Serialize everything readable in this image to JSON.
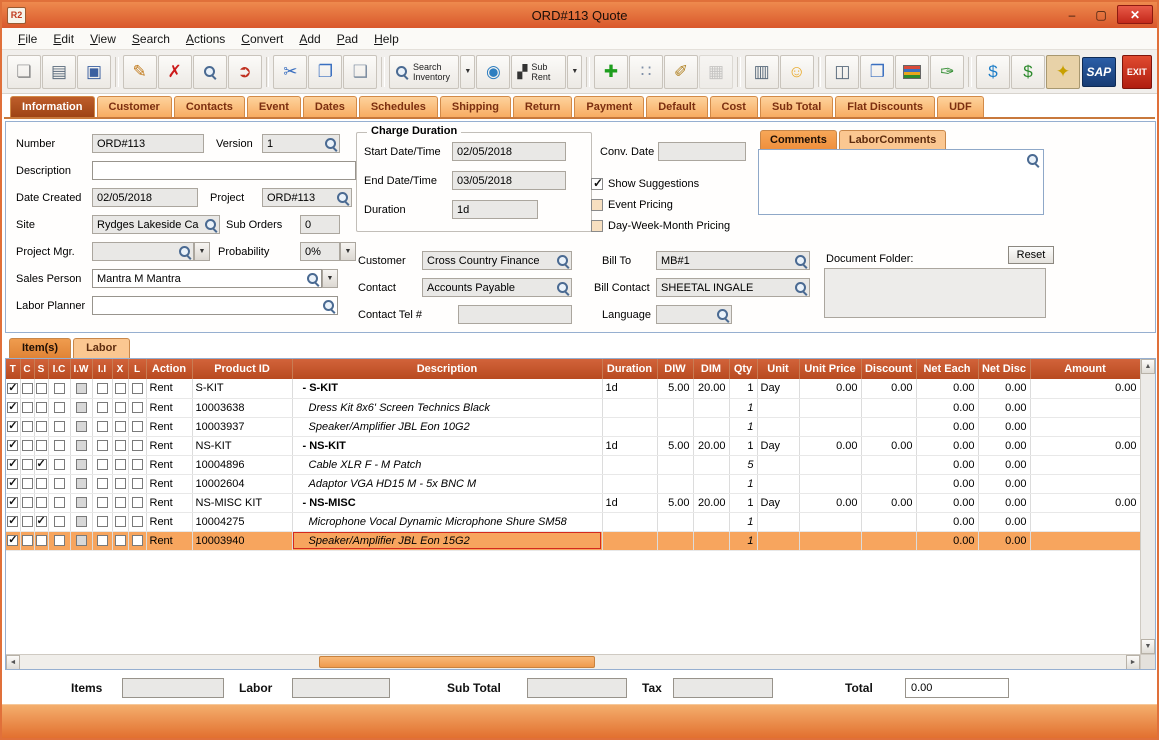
{
  "window": {
    "title": "ORD#113 Quote",
    "logo_text": "R2",
    "controls": {
      "minimize": "–",
      "maximize": "▢",
      "close": "✕"
    }
  },
  "menu": {
    "items": [
      "File",
      "Edit",
      "View",
      "Search",
      "Actions",
      "Convert",
      "Add",
      "Pad",
      "Help"
    ]
  },
  "toolbar": {
    "items": [
      {
        "name": "new-document-icon",
        "kind": "icon",
        "glyph": "❏",
        "color": "#8A8A8A"
      },
      {
        "name": "print-icon",
        "kind": "icon",
        "glyph": "▤",
        "color": "#5A6B7C"
      },
      {
        "name": "save-icon",
        "kind": "icon",
        "glyph": "▣",
        "color": "#3A5FA0"
      },
      {
        "name": "sep1",
        "kind": "sep"
      },
      {
        "name": "edit-icon",
        "kind": "icon",
        "glyph": "✎",
        "color": "#C07818"
      },
      {
        "name": "delete-icon",
        "kind": "icon",
        "glyph": "✗",
        "color": "#CC1A1A"
      },
      {
        "name": "find-icon",
        "kind": "mag"
      },
      {
        "name": "export-icon",
        "kind": "icon",
        "glyph": "➲",
        "color": "#C03020"
      },
      {
        "name": "sep2",
        "kind": "sep"
      },
      {
        "name": "cut-icon",
        "kind": "icon",
        "glyph": "✂",
        "color": "#3A6FC0"
      },
      {
        "name": "copy-icon",
        "kind": "icon",
        "glyph": "❐",
        "color": "#3A6FC0"
      },
      {
        "name": "paste-icon",
        "kind": "icon",
        "glyph": "❑",
        "color": "#7C8CA0"
      },
      {
        "name": "sep3",
        "kind": "sep"
      },
      {
        "name": "search-inventory-button",
        "kind": "labelmag",
        "label": "Search Inventory"
      },
      {
        "name": "search-inventory-dropdown",
        "kind": "dd"
      },
      {
        "name": "web-search-icon",
        "kind": "icon",
        "glyph": "◉",
        "color": "#2E7EC0"
      },
      {
        "name": "sub-rent-button",
        "kind": "label",
        "glyph": "▞",
        "color": "#333333",
        "label": "Sub Rent"
      },
      {
        "name": "sub-rent-dropdown",
        "kind": "dd"
      },
      {
        "name": "sep4",
        "kind": "sep"
      },
      {
        "name": "add-item-icon",
        "kind": "icon",
        "glyph": "✚",
        "color": "#1E9E1E"
      },
      {
        "name": "kit-group-icon",
        "kind": "icon",
        "glyph": "∷",
        "color": "#8090A8"
      },
      {
        "name": "notes-icon",
        "kind": "icon",
        "glyph": "✐",
        "color": "#B08020"
      },
      {
        "name": "grid-icon",
        "kind": "icon",
        "glyph": "▦",
        "color": "#9A9A9A",
        "disabled": true
      },
      {
        "name": "sep5",
        "kind": "sep"
      },
      {
        "name": "fax-icon",
        "kind": "icon",
        "glyph": "▥",
        "color": "#5A6B7C"
      },
      {
        "name": "smiley-icon",
        "kind": "icon",
        "glyph": "☺",
        "color": "#E8A51E"
      },
      {
        "name": "sep6",
        "kind": "sep"
      },
      {
        "name": "camera-icon",
        "kind": "icon",
        "glyph": "◫",
        "color": "#5A6B7C"
      },
      {
        "name": "package-icon",
        "kind": "icon",
        "glyph": "❒",
        "color": "#3A6FC0"
      },
      {
        "name": "catalog-stack-icon",
        "kind": "stack"
      },
      {
        "name": "document-edit-icon",
        "kind": "icon",
        "glyph": "✑",
        "color": "#2E8B2E"
      },
      {
        "name": "sep7",
        "kind": "sep"
      },
      {
        "name": "currency-transfer-icon",
        "kind": "icon",
        "glyph": "$",
        "color": "#1E7EC8"
      },
      {
        "name": "price-list-icon",
        "kind": "icon",
        "glyph": "$",
        "color": "#2E8B2E"
      },
      {
        "name": "security-key-icon",
        "kind": "icon",
        "glyph": "✦",
        "color": "#C8A000",
        "pressed": true
      }
    ],
    "sap_label": "SAP",
    "exit_label": "EXIT"
  },
  "main_tabs": [
    "Information",
    "Customer",
    "Contacts",
    "Event",
    "Dates",
    "Schedules",
    "Shipping",
    "Return",
    "Payment",
    "Default",
    "Cost",
    "Sub Total",
    "Flat Discounts",
    "UDF"
  ],
  "selected_main_tab": "Information",
  "info_form": {
    "number": {
      "label": "Number",
      "value": "ORD#113"
    },
    "version": {
      "label": "Version",
      "value": "1"
    },
    "description": {
      "label": "Description",
      "value": ""
    },
    "date_created": {
      "label": "Date Created",
      "value": "02/05/2018"
    },
    "project": {
      "label": "Project",
      "value": "ORD#113"
    },
    "site": {
      "label": "Site",
      "value": "Rydges Lakeside Ca"
    },
    "sub_orders": {
      "label": "Sub Orders",
      "value": "0"
    },
    "project_mgr": {
      "label": "Project Mgr.",
      "value": ""
    },
    "probability": {
      "label": "Probability",
      "value": "0%"
    },
    "sales_person": {
      "label": "Sales Person",
      "value": "Mantra M Mantra"
    },
    "labor_planner": {
      "label": "Labor Planner",
      "value": ""
    }
  },
  "charge_duration": {
    "title": "Charge Duration",
    "start": {
      "label": "Start Date/Time",
      "value": "02/05/2018"
    },
    "end": {
      "label": "End Date/Time",
      "value": "03/05/2018"
    },
    "duration": {
      "label": "Duration",
      "value": "1d"
    },
    "conv_date": {
      "label": "Conv. Date",
      "value": ""
    },
    "checkboxes": [
      {
        "label": "Show Suggestions",
        "checked": true
      },
      {
        "label": "Event Pricing",
        "checked": false
      },
      {
        "label": "Day-Week-Month Pricing",
        "checked": false
      }
    ]
  },
  "parties": {
    "customer": {
      "label": "Customer",
      "value": "Cross Country Finance"
    },
    "bill_to": {
      "label": "Bill To",
      "value": "MB#1"
    },
    "contact": {
      "label": "Contact",
      "value": "Accounts Payable"
    },
    "bill_contact": {
      "label": "Bill Contact",
      "value": "SHEETAL INGALE"
    },
    "contact_tel": {
      "label": "Contact Tel #",
      "value": ""
    },
    "language": {
      "label": "Language",
      "value": ""
    }
  },
  "comments": {
    "tabs": [
      "Comments",
      "LaborComments"
    ],
    "selected_tab": "Comments",
    "text": "",
    "document_folder_label": "Document Folder:",
    "reset_button": "Reset"
  },
  "item_tabs": [
    "Item(s)",
    "Labor"
  ],
  "selected_item_tab": "Item(s)",
  "items_table": {
    "headers": [
      "T",
      "C",
      "S",
      "I.C",
      "I.W",
      "I.I",
      "X",
      "L",
      "Action",
      "Product ID",
      "Description",
      "Duration",
      "DIW",
      "DIM",
      "Qty",
      "Unit",
      "Unit Price",
      "Discount",
      "Net Each",
      "Net Disc",
      "Amount"
    ],
    "rows": [
      {
        "checks": [
          1,
          0,
          0,
          0,
          0,
          0,
          0,
          0
        ],
        "action": "Rent",
        "product_id": "S-KIT",
        "description": "-  S-KIT",
        "style": "kit",
        "duration": "1d",
        "diw": "5.00",
        "dim": "20.00",
        "qty": "1",
        "unit": "Day",
        "unit_price": "0.00",
        "discount": "0.00",
        "net_each": "0.00",
        "net_disc": "0.00",
        "amount": "0.00",
        "selected": false
      },
      {
        "checks": [
          1,
          0,
          0,
          0,
          0,
          0,
          0,
          0
        ],
        "action": "Rent",
        "product_id": "10003638",
        "description": "Dress Kit 8x6' Screen Technics Black",
        "style": "child",
        "duration": "",
        "diw": "",
        "dim": "",
        "qty": "1",
        "unit": "",
        "unit_price": "",
        "discount": "",
        "net_each": "0.00",
        "net_disc": "0.00",
        "amount": "",
        "selected": false
      },
      {
        "checks": [
          1,
          0,
          0,
          0,
          0,
          0,
          0,
          0
        ],
        "action": "Rent",
        "product_id": "10003937",
        "description": "Speaker/Amplifier JBL Eon 10G2",
        "style": "child",
        "duration": "",
        "diw": "",
        "dim": "",
        "qty": "1",
        "unit": "",
        "unit_price": "",
        "discount": "",
        "net_each": "0.00",
        "net_disc": "0.00",
        "amount": "",
        "selected": false
      },
      {
        "checks": [
          1,
          0,
          0,
          0,
          0,
          0,
          0,
          0
        ],
        "action": "Rent",
        "product_id": "NS-KIT",
        "description": "-  NS-KIT",
        "style": "kit",
        "duration": "1d",
        "diw": "5.00",
        "dim": "20.00",
        "qty": "1",
        "unit": "Day",
        "unit_price": "0.00",
        "discount": "0.00",
        "net_each": "0.00",
        "net_disc": "0.00",
        "amount": "0.00",
        "selected": false
      },
      {
        "checks": [
          1,
          0,
          1,
          0,
          0,
          0,
          0,
          0
        ],
        "action": "Rent",
        "product_id": "10004896",
        "description": "Cable XLR F - M Patch",
        "style": "child",
        "duration": "",
        "diw": "",
        "dim": "",
        "qty": "5",
        "unit": "",
        "unit_price": "",
        "discount": "",
        "net_each": "0.00",
        "net_disc": "0.00",
        "amount": "",
        "selected": false
      },
      {
        "checks": [
          1,
          0,
          0,
          0,
          0,
          0,
          0,
          0
        ],
        "action": "Rent",
        "product_id": "10002604",
        "description": "Adaptor VGA HD15 M - 5x BNC M",
        "style": "child",
        "duration": "",
        "diw": "",
        "dim": "",
        "qty": "1",
        "unit": "",
        "unit_price": "",
        "discount": "",
        "net_each": "0.00",
        "net_disc": "0.00",
        "amount": "",
        "selected": false
      },
      {
        "checks": [
          1,
          0,
          0,
          0,
          0,
          0,
          0,
          0
        ],
        "action": "Rent",
        "product_id": "NS-MISC KIT",
        "description": "-  NS-MISC",
        "style": "kit",
        "duration": "1d",
        "diw": "5.00",
        "dim": "20.00",
        "qty": "1",
        "unit": "Day",
        "unit_price": "0.00",
        "discount": "0.00",
        "net_each": "0.00",
        "net_disc": "0.00",
        "amount": "0.00",
        "selected": false
      },
      {
        "checks": [
          1,
          0,
          1,
          0,
          0,
          0,
          0,
          0
        ],
        "action": "Rent",
        "product_id": "10004275",
        "description": "Microphone Vocal Dynamic Microphone Shure SM58",
        "style": "child",
        "duration": "",
        "diw": "",
        "dim": "",
        "qty": "1",
        "unit": "",
        "unit_price": "",
        "discount": "",
        "net_each": "0.00",
        "net_disc": "0.00",
        "amount": "",
        "selected": false
      },
      {
        "checks": [
          1,
          0,
          0,
          0,
          0,
          0,
          0,
          0
        ],
        "action": "Rent",
        "product_id": "10003940",
        "description": "Speaker/Amplifier JBL Eon 15G2",
        "style": "child",
        "duration": "",
        "diw": "",
        "dim": "",
        "qty": "1",
        "unit": "",
        "unit_price": "",
        "discount": "",
        "net_each": "0.00",
        "net_disc": "0.00",
        "amount": "",
        "selected": true
      }
    ]
  },
  "totals": {
    "items": {
      "label": "Items",
      "value": ""
    },
    "labor": {
      "label": "Labor",
      "value": ""
    },
    "sub_total": {
      "label": "Sub Total",
      "value": ""
    },
    "tax": {
      "label": "Tax",
      "value": ""
    },
    "total": {
      "label": "Total",
      "value": "0.00"
    }
  }
}
